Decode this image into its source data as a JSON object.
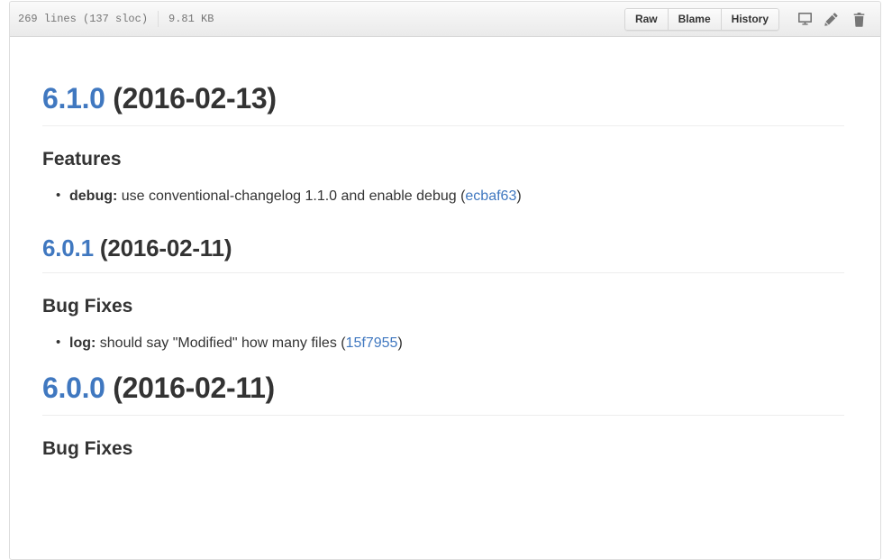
{
  "header": {
    "lines_info": "269 lines (137 sloc)",
    "file_size": "9.81 KB",
    "buttons": [
      {
        "label": "Raw",
        "name": "raw-button"
      },
      {
        "label": "Blame",
        "name": "blame-button"
      },
      {
        "label": "History",
        "name": "history-button"
      }
    ],
    "icons": [
      {
        "name": "desktop-icon",
        "title": "Open in desktop"
      },
      {
        "name": "pencil-icon",
        "title": "Edit this file"
      },
      {
        "name": "trash-icon",
        "title": "Delete this file"
      }
    ]
  },
  "document": {
    "releases": [
      {
        "version": "6.1.0",
        "date": "(2016-02-13)",
        "level": "h1",
        "sections": [
          {
            "heading": "Features",
            "items": [
              {
                "scope": "debug:",
                "text": " use conventional-changelog 1.1.0 and enable debug (",
                "hash": "ecbaf63",
                "suffix": ")"
              }
            ]
          }
        ]
      },
      {
        "version": "6.0.1",
        "date": "(2016-02-11)",
        "level": "h2",
        "sections": [
          {
            "heading": "Bug Fixes",
            "items": [
              {
                "scope": "log:",
                "text": " should say \"Modified\" how many files (",
                "hash": "15f7955",
                "suffix": ")"
              }
            ]
          }
        ]
      },
      {
        "version": "6.0.0",
        "date": "(2016-02-11)",
        "level": "h1",
        "sections": [
          {
            "heading": "Bug Fixes",
            "items": []
          }
        ]
      }
    ]
  },
  "colors": {
    "link_blue": "#4078c0",
    "text": "#333333",
    "muted": "#767676",
    "header_bg": "#f7f7f7",
    "border": "#dddddd",
    "rule": "#eeeeee"
  }
}
